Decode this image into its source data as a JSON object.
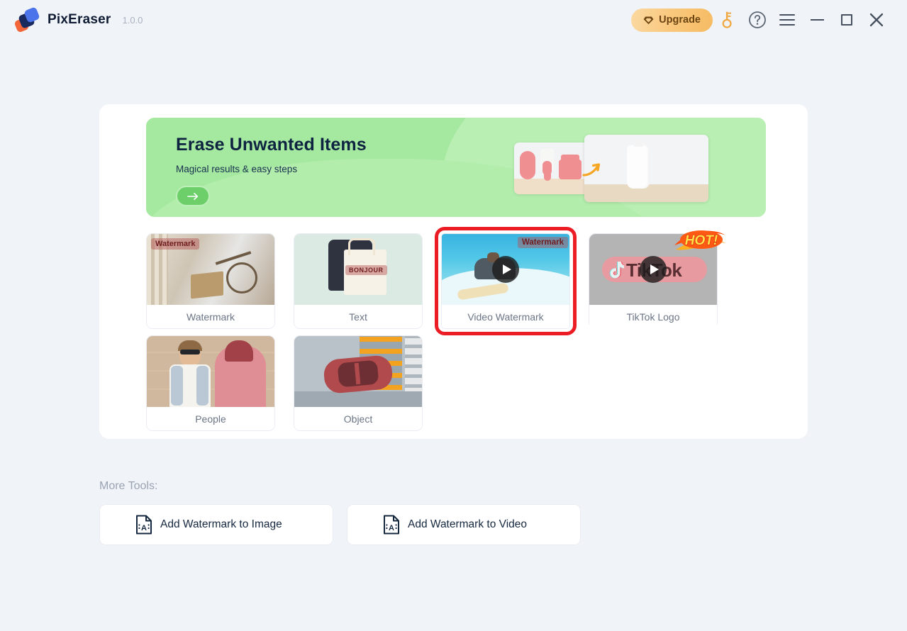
{
  "app": {
    "name": "PixEraser",
    "version": "1.0.0",
    "logo_icon": "pixeraser-logo-icon"
  },
  "titlebar": {
    "upgrade_label": "Upgrade",
    "upgrade_icon": "diamond-icon",
    "key_icon": "key-icon",
    "help_icon": "question-mark-circle-icon",
    "menu_icon": "hamburger-menu-icon",
    "minimize_icon": "minimize-icon",
    "maximize_icon": "maximize-icon",
    "close_icon": "close-x-icon",
    "colors": {
      "upgrade_gradient_start": "#fbd9a2",
      "upgrade_gradient_end": "#f6bb63",
      "upgrade_text": "#6b4412",
      "key_accent": "#f0a840",
      "control_icon": "#46505f"
    }
  },
  "hero": {
    "title": "Erase Unwanted Items",
    "subtitle": "Magical results & easy steps",
    "cta_icon": "arrow-right-icon",
    "before_image_alt": "pink-cosmetic-products-photo",
    "after_image_alt": "white-bottle-photo",
    "transform_arrow_icon": "curved-arrow-icon",
    "colors": {
      "background": "#a5e8a0",
      "title": "#0e2340",
      "cta": "#6dcf6a"
    }
  },
  "tools": [
    {
      "id": "watermark",
      "label": "Watermark",
      "thumb_alt": "bicycle-in-snow-photo",
      "overlay_text": "Watermark",
      "selected": false,
      "has_play": false,
      "badge": null
    },
    {
      "id": "text",
      "label": "Text",
      "thumb_alt": "tote-bag-photo",
      "overlay_text": "BONJOUR",
      "selected": false,
      "has_play": false,
      "badge": null
    },
    {
      "id": "video-watermark",
      "label": "Video Watermark",
      "thumb_alt": "surfer-on-wave-photo",
      "overlay_text": "Watermark",
      "selected": true,
      "has_play": true,
      "badge": null
    },
    {
      "id": "tiktok-logo",
      "label": "TikTok Logo",
      "thumb_alt": "tiktok-logo-photo",
      "overlay_text": "TikTok",
      "selected": false,
      "has_play": true,
      "badge": "HOT!"
    },
    {
      "id": "people",
      "label": "People",
      "thumb_alt": "man-with-sunglasses-photo",
      "overlay_text": "",
      "selected": false,
      "has_play": false,
      "badge": null
    },
    {
      "id": "object",
      "label": "Object",
      "thumb_alt": "red-car-aerial-photo",
      "overlay_text": "",
      "selected": false,
      "has_play": false,
      "badge": null
    }
  ],
  "more_tools": {
    "heading": "More Tools:",
    "items": [
      {
        "id": "add-watermark-image",
        "label": "Add Watermark to Image",
        "icon": "document-text-icon"
      },
      {
        "id": "add-watermark-video",
        "label": "Add Watermark to Video",
        "icon": "document-text-icon"
      }
    ]
  },
  "colors": {
    "page_background": "#f0f3f8",
    "panel_background": "#ffffff",
    "selection_outline": "#ec1c24",
    "card_label_text": "#6b7585"
  }
}
